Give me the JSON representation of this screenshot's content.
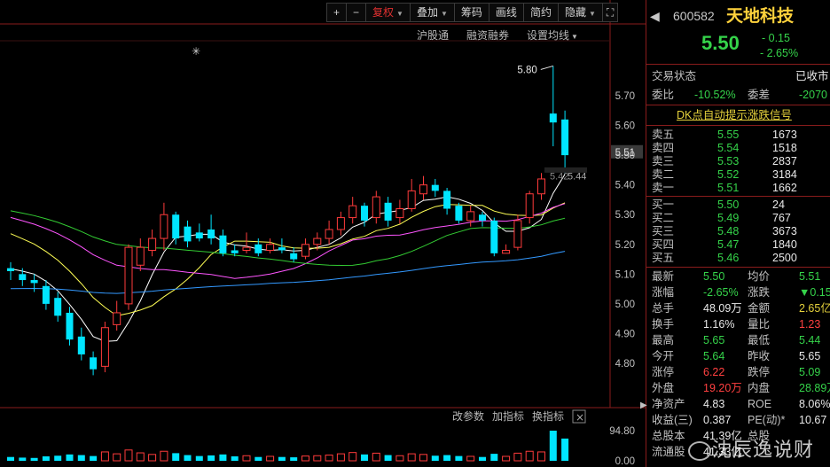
{
  "toolbar": {
    "plus": "+",
    "minus": "−",
    "items": [
      "复权",
      "叠加",
      "筹码",
      "画线",
      "简约",
      "隐藏"
    ],
    "expand_icon": "expand-icon"
  },
  "subbar": {
    "items": [
      "沪股通",
      "融资融券",
      "设置均线"
    ]
  },
  "chart": {
    "price_axis": [
      "5.70",
      "5.60",
      "5.51",
      "5.50",
      "5.40",
      "5.30",
      "5.20",
      "5.10",
      "5.00",
      "4.90",
      "4.80"
    ],
    "current_price_tag": "5.51",
    "high_marker": "5.80",
    "ref_label": "5.42",
    "ref_label2": "5.44",
    "star": "✳",
    "volume_axis_top": "94.80",
    "volume_axis_bottom": "0.00",
    "volume_toolbar": [
      "改参数",
      "加指标",
      "换指标"
    ],
    "close_icon": "×"
  },
  "chart_data": {
    "type": "candlestick",
    "ylim": [
      4.75,
      5.82
    ],
    "candles": [
      {
        "o": 5.12,
        "c": 5.11,
        "h": 5.14,
        "l": 5.08
      },
      {
        "o": 5.1,
        "c": 5.08,
        "h": 5.12,
        "l": 5.06
      },
      {
        "o": 5.08,
        "c": 5.07,
        "h": 5.1,
        "l": 5.04
      },
      {
        "o": 5.06,
        "c": 5.0,
        "h": 5.08,
        "l": 4.98
      },
      {
        "o": 5.02,
        "c": 4.96,
        "h": 5.04,
        "l": 4.94
      },
      {
        "o": 4.97,
        "c": 4.88,
        "h": 4.99,
        "l": 4.86
      },
      {
        "o": 4.89,
        "c": 4.83,
        "h": 4.92,
        "l": 4.81
      },
      {
        "o": 4.82,
        "c": 4.78,
        "h": 4.84,
        "l": 4.76
      },
      {
        "o": 4.79,
        "c": 4.92,
        "h": 4.94,
        "l": 4.77
      },
      {
        "o": 4.93,
        "c": 4.97,
        "h": 5.01,
        "l": 4.91
      },
      {
        "o": 5.0,
        "c": 5.19,
        "h": 5.2,
        "l": 4.98
      },
      {
        "o": 5.13,
        "c": 5.19,
        "h": 5.22,
        "l": 5.11
      },
      {
        "o": 5.18,
        "c": 5.22,
        "h": 5.25,
        "l": 5.16
      },
      {
        "o": 5.22,
        "c": 5.3,
        "h": 5.34,
        "l": 5.18
      },
      {
        "o": 5.3,
        "c": 5.22,
        "h": 5.31,
        "l": 5.2
      },
      {
        "o": 5.26,
        "c": 5.21,
        "h": 5.28,
        "l": 5.19
      },
      {
        "o": 5.24,
        "c": 5.22,
        "h": 5.27,
        "l": 5.21
      },
      {
        "o": 5.25,
        "c": 5.22,
        "h": 5.3,
        "l": 5.2
      },
      {
        "o": 5.23,
        "c": 5.17,
        "h": 5.25,
        "l": 5.16
      },
      {
        "o": 5.18,
        "c": 5.17,
        "h": 5.2,
        "l": 5.16
      },
      {
        "o": 5.18,
        "c": 5.19,
        "h": 5.24,
        "l": 5.17
      },
      {
        "o": 5.2,
        "c": 5.17,
        "h": 5.22,
        "l": 5.16
      },
      {
        "o": 5.18,
        "c": 5.2,
        "h": 5.22,
        "l": 5.17
      },
      {
        "o": 5.19,
        "c": 5.18,
        "h": 5.22,
        "l": 5.17
      },
      {
        "o": 5.17,
        "c": 5.15,
        "h": 5.19,
        "l": 5.14
      },
      {
        "o": 5.16,
        "c": 5.2,
        "h": 5.22,
        "l": 5.15
      },
      {
        "o": 5.2,
        "c": 5.22,
        "h": 5.24,
        "l": 5.18
      },
      {
        "o": 5.22,
        "c": 5.25,
        "h": 5.28,
        "l": 5.2
      },
      {
        "o": 5.25,
        "c": 5.29,
        "h": 5.31,
        "l": 5.23
      },
      {
        "o": 5.29,
        "c": 5.33,
        "h": 5.36,
        "l": 5.27
      },
      {
        "o": 5.33,
        "c": 5.28,
        "h": 5.34,
        "l": 5.26
      },
      {
        "o": 5.29,
        "c": 5.36,
        "h": 5.38,
        "l": 5.27
      },
      {
        "o": 5.34,
        "c": 5.28,
        "h": 5.36,
        "l": 5.26
      },
      {
        "o": 5.29,
        "c": 5.32,
        "h": 5.35,
        "l": 5.27
      },
      {
        "o": 5.32,
        "c": 5.38,
        "h": 5.42,
        "l": 5.31
      },
      {
        "o": 5.37,
        "c": 5.4,
        "h": 5.43,
        "l": 5.35
      },
      {
        "o": 5.4,
        "c": 5.38,
        "h": 5.42,
        "l": 5.36
      },
      {
        "o": 5.38,
        "c": 5.32,
        "h": 5.39,
        "l": 5.3
      },
      {
        "o": 5.33,
        "c": 5.28,
        "h": 5.34,
        "l": 5.27
      },
      {
        "o": 5.28,
        "c": 5.31,
        "h": 5.33,
        "l": 5.26
      },
      {
        "o": 5.3,
        "c": 5.28,
        "h": 5.31,
        "l": 5.26
      },
      {
        "o": 5.28,
        "c": 5.17,
        "h": 5.29,
        "l": 5.16
      },
      {
        "o": 5.17,
        "c": 5.18,
        "h": 5.2,
        "l": 5.17
      },
      {
        "o": 5.19,
        "c": 5.28,
        "h": 5.3,
        "l": 5.18
      },
      {
        "o": 5.29,
        "c": 5.37,
        "h": 5.38,
        "l": 5.27
      },
      {
        "o": 5.37,
        "c": 5.42,
        "h": 5.44,
        "l": 5.35
      },
      {
        "o": 5.64,
        "c": 5.61,
        "h": 5.8,
        "l": 5.53
      },
      {
        "o": 5.62,
        "c": 5.5,
        "h": 5.65,
        "l": 5.44
      }
    ],
    "volumes": [
      12,
      10,
      9,
      14,
      16,
      20,
      18,
      15,
      28,
      22,
      34,
      25,
      20,
      30,
      24,
      18,
      15,
      17,
      20,
      14,
      16,
      12,
      14,
      12,
      11,
      15,
      16,
      18,
      22,
      26,
      20,
      24,
      18,
      16,
      22,
      20,
      16,
      18,
      15,
      14,
      12,
      22,
      14,
      24,
      30,
      28,
      94.8,
      70
    ],
    "vol_ylim": [
      0,
      94.8
    ]
  },
  "quote": {
    "code": "600582",
    "name": "天地科技",
    "price": "5.50",
    "change": "- 0.15",
    "change_pct": "- 2.65%",
    "status_label": "交易状态",
    "status_value": "已收市",
    "weibi_label": "委比",
    "weibi_value": "-10.52%",
    "weicha_label": "委差",
    "weicha_value": "-2070",
    "dk_signal": "DK点自动提示涨跌信号",
    "asks": [
      {
        "label": "卖五",
        "price": "5.55",
        "vol": "1673"
      },
      {
        "label": "卖四",
        "price": "5.54",
        "vol": "1518"
      },
      {
        "label": "卖三",
        "price": "5.53",
        "vol": "2837"
      },
      {
        "label": "卖二",
        "price": "5.52",
        "vol": "3184"
      },
      {
        "label": "卖一",
        "price": "5.51",
        "vol": "1662"
      }
    ],
    "bids": [
      {
        "label": "买一",
        "price": "5.50",
        "vol": "24"
      },
      {
        "label": "买二",
        "price": "5.49",
        "vol": "767"
      },
      {
        "label": "买三",
        "price": "5.48",
        "vol": "3673"
      },
      {
        "label": "买四",
        "price": "5.47",
        "vol": "1840"
      },
      {
        "label": "买五",
        "price": "5.46",
        "vol": "2500"
      }
    ],
    "stats": [
      {
        "l1": "最新",
        "v1": "5.50",
        "c1": "g",
        "l2": "均价",
        "v2": "5.51",
        "c2": "g"
      },
      {
        "l1": "涨幅",
        "v1": "-2.65%",
        "c1": "g",
        "l2": "涨跌",
        "v2": "▼0.15",
        "c2": "g"
      },
      {
        "l1": "总手",
        "v1": "48.09万",
        "c1": "w",
        "l2": "金额",
        "v2": "2.65亿",
        "c2": "y"
      },
      {
        "l1": "换手",
        "v1": "1.16%",
        "c1": "w",
        "l2": "量比",
        "v2": "1.23",
        "c2": "r"
      },
      {
        "l1": "最高",
        "v1": "5.65",
        "c1": "g",
        "l2": "最低",
        "v2": "5.44",
        "c2": "g"
      },
      {
        "l1": "今开",
        "v1": "5.64",
        "c1": "g",
        "l2": "昨收",
        "v2": "5.65",
        "c2": "w"
      },
      {
        "l1": "涨停",
        "v1": "6.22",
        "c1": "r",
        "l2": "跌停",
        "v2": "5.09",
        "c2": "g"
      },
      {
        "l1": "外盘",
        "v1": "19.20万",
        "c1": "r",
        "l2": "内盘",
        "v2": "28.89万",
        "c2": "g"
      },
      {
        "l1": "净资产",
        "v1": "4.83",
        "c1": "w",
        "l2": "ROE",
        "v2": "8.06%",
        "c2": "w"
      },
      {
        "l1": "收益(三)",
        "v1": "0.387",
        "c1": "w",
        "l2": "PE(动)*",
        "v2": "10.67",
        "c2": "w"
      },
      {
        "l1": "总股本",
        "v1": "41.39亿",
        "c1": "w",
        "l2": "总股",
        "v2": "",
        "c2": "w"
      },
      {
        "l1": "流通股",
        "v1": "41.33亿",
        "c1": "w",
        "l2": "",
        "v2": "",
        "c2": "w"
      }
    ],
    "watermark": "沈辰逸说财"
  },
  "colors": {
    "up": "#ff3b3b",
    "down": "#00e5ff",
    "ma1": "#ffffff",
    "ma2": "#ffff55",
    "ma3": "#ff55ff",
    "ma4": "#33cc33",
    "ma5": "#3399ff"
  }
}
